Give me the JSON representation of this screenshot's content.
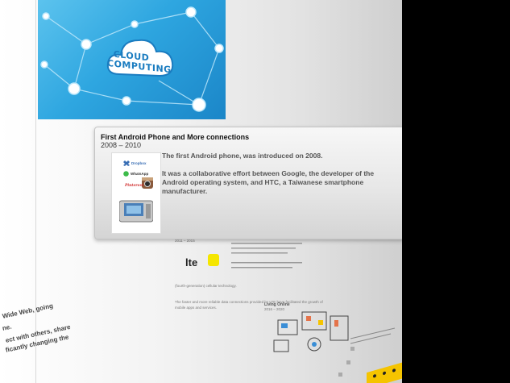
{
  "popup": {
    "title": "First Android Phone and More connections",
    "years": "2008 – 2010",
    "body_line1": "The first Android phone, was introduced on 2008.",
    "body_line2": "It was a collaborative effort between Google, the developer of the Android operating system, and HTC, a Taiwanese smartphone manufacturer.",
    "thumb_apps": [
      "Dropbox",
      "WhatsApp",
      "Pinterest"
    ]
  },
  "banner": {
    "text_line1": "CLOUD",
    "text_line2": "COMPUTING"
  },
  "lower": {
    "section_years": "2011 – 2015",
    "lte_label": "lte",
    "caption1": "(fourth-generation) cellular technology.",
    "caption2": "The faster and more reliable data connections provided by LTE have facilitated the growth of",
    "caption3": "mobile apps and services.",
    "living_online": "Living Online",
    "living_years": "2016 – 2020"
  },
  "left_fragments": {
    "line1": "Wide Web, going",
    "line2": "ne.",
    "line3": "ect with others, share",
    "line4": "ficantly changing the"
  }
}
